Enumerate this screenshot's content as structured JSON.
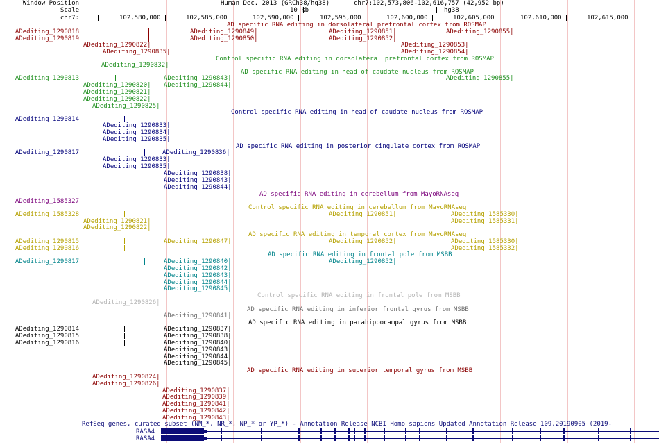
{
  "header": {
    "window_position_label": "Window Position",
    "scale_label": "Scale",
    "chrom_label": "chr7:",
    "assembly": "Human Dec. 2013 (GRCh38/hg38)",
    "position": "chr7:102,573,806-102,616,757 (42,952 bp)",
    "scale_text": "10 kb",
    "scale_assembly": "hg38",
    "ruler_ticks": [
      "102,580,000",
      "102,585,000",
      "102,590,000",
      "102,595,000",
      "102,600,000",
      "102,605,000",
      "102,610,000",
      "102,615,000"
    ]
  },
  "colors": {
    "darkred": "#8b0000",
    "green": "#1f8f1f",
    "navy": "#00007a",
    "purple": "#7a007a",
    "olive": "#b5a100",
    "teal": "#00838a",
    "gray": "#b4b4b4",
    "gene": "#0c0c78"
  },
  "tracks": {
    "t01": "AD specific RNA editing in dorsolateral prefrontal cortex from ROSMAP",
    "t02": "Control specific RNA editing in dorsolateral prefrontal cortex from ROSMAP",
    "t03": "AD specific RNA editing in head of caudate nucleus from ROSMAP",
    "t04": "Control specific RNA editing in head of caudate nucleus from ROSMAP",
    "t05": "AD specific RNA editing in posterior cingulate cortex from ROSMAP",
    "t06": "AD specific RNA editing in cerebellum from MayoRNAseq",
    "t07": "Control specific RNA editing in cerebellum from MayoRNAseq",
    "t08": "AD specific RNA editing in temporal cortex from MayoRNAseq",
    "t09": "AD specific RNA editing in frontal pole from MSBB",
    "t10": "Control specific RNA editing in frontal pole from MSBB",
    "t11": "AD specific RNA editing in inferior frontal gyrus from MSBB",
    "t12": "AD specific RNA editing in parahippocampal gyrus from MSBB",
    "t13": "AD specific RNA editing in superior temporal gyrus from MSBB",
    "genes": "RefSeq genes, curated subset (NM_*, NR_*, NP_* or YP_*) - Annotation Release NCBI Homo sapiens Updated Annotation Release 109.20190905 (2019-"
  },
  "side": {
    "a1": "ADediting_1290818",
    "a2": "ADediting_1290819",
    "b1": "ADediting_1290813",
    "c1": "ADediting_1290814",
    "d1": "ADediting_1290817",
    "e1": "ADediting_1585327",
    "f1": "ADediting_1585328",
    "g1": "ADediting_1290815",
    "g2": "ADediting_1290816",
    "h1": "ADediting_1290817",
    "i1": "ADediting_1290814",
    "i2": "ADediting_1290815",
    "i3": "ADediting_1290816"
  },
  "items": {
    "r01a": "ADediting_1290849|",
    "r01b": "ADediting_1290851|",
    "r01c": "ADediting_1290855|",
    "r02a": "ADediting_1290850|",
    "r02b": "ADediting_1290852|",
    "r03a": "ADediting_1290822|",
    "r03b": "ADediting_1290853|",
    "r04a": "ADediting_1290835|",
    "r04b": "ADediting_1290854|",
    "r05a": "ADediting_1290832|",
    "r06a": "ADediting_1290843|",
    "r06b": "ADediting_1290855|",
    "r07a": "ADediting_1290820|",
    "r07b": "ADediting_1290844|",
    "r08a": "ADediting_1290821|",
    "r09a": "ADediting_1290822|",
    "r10a": "ADediting_1290825|",
    "r11a": "ADediting_1290833|",
    "r12a": "ADediting_1290834|",
    "r13a": "ADediting_1290835|",
    "r14a": "ADediting_1290836|",
    "r15a": "ADediting_1290833|",
    "r16a": "ADediting_1290835|",
    "r17a": "ADediting_1290838|",
    "r18a": "ADediting_1290843|",
    "r19a": "ADediting_1290844|",
    "r20a": "ADediting_1290851|",
    "r20b": "ADediting_1585330|",
    "r21a": "ADediting_1290821|",
    "r21b": "ADediting_1585331|",
    "r22a": "ADediting_1290822|",
    "r23a": "ADediting_1290847|",
    "r23b": "ADediting_1290852|",
    "r23c": "ADediting_1585330|",
    "r24a": "ADediting_1585332|",
    "r25a": "ADediting_1290840|",
    "r25b": "ADediting_1290852|",
    "r26a": "ADediting_1290842|",
    "r27a": "ADediting_1290843|",
    "r28a": "ADediting_1290844|",
    "r29a": "ADediting_1290845|",
    "r30a": "ADediting_1290826|",
    "r31a": "ADediting_1290841|",
    "r32a": "ADediting_1290837|",
    "r33a": "ADediting_1290838|",
    "r34a": "ADediting_1290840|",
    "r35a": "ADediting_1290843|",
    "r36a": "ADediting_1290844|",
    "r37a": "ADediting_1290845|",
    "r38a": "ADediting_1290824|",
    "r39a": "ADediting_1290826|",
    "r40a": "ADediting_1290837|",
    "r41a": "ADediting_1290839|",
    "r42a": "ADediting_1290841|",
    "r43a": "ADediting_1290842|",
    "r44a": "ADediting_1290843|"
  },
  "gene_labels": [
    "RASA4",
    "RASA4"
  ]
}
